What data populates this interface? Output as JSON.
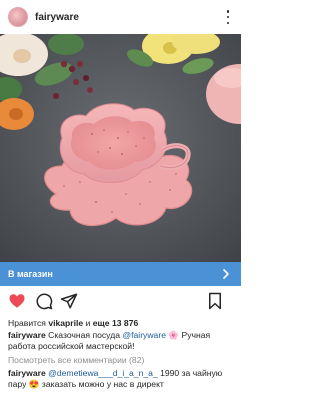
{
  "post": {
    "username": "fairyware",
    "shop_label": "В магазин",
    "likes_prefix": "Нравится",
    "likes_user": "vikaprile",
    "likes_and": "и",
    "likes_more": "еще 13 876",
    "caption_user": "fairyware",
    "caption_text_1": "Сказочная посуда",
    "caption_mention": "@fairyware",
    "caption_emoji": "🌸",
    "caption_text_2": "Ручная работа российской мастерской!",
    "view_comments": "Посмотреть все комментарии (82)",
    "comment_user": "fairyware",
    "comment_mention": "@demetiewa___d_i_a_n_a_",
    "comment_text_1": "1990 за чайную пару",
    "comment_emoji": "😍",
    "comment_text_2": "заказать можно у нас в директ"
  },
  "icons": [
    "more-icon",
    "heart-icon",
    "comment-icon",
    "share-icon",
    "bookmark-icon",
    "chevron-right-icon"
  ],
  "colors": {
    "like_heart": "#ed4956",
    "shop_bar": "#4b91d6",
    "link": "#1e5c9a",
    "muted": "#8e8e8e"
  }
}
